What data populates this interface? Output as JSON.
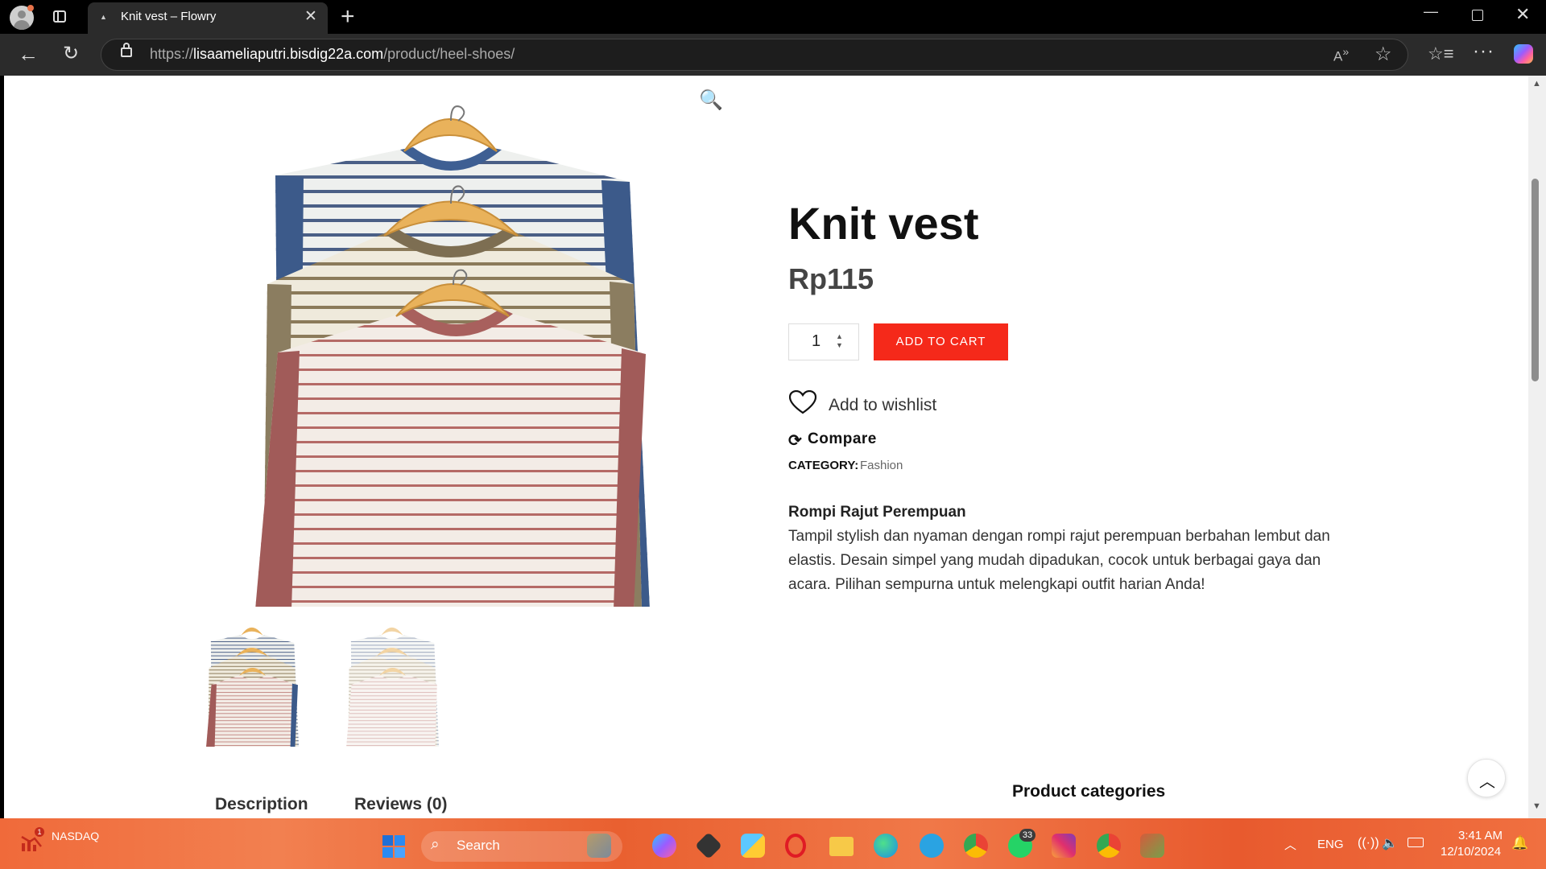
{
  "browser": {
    "tab_title": "Knit vest – Flowry",
    "url_scheme": "https://",
    "url_host": "lisaameliaputri.bisdig22a.com",
    "url_path": "/product/heel-shoes/"
  },
  "product": {
    "title": "Knit vest",
    "price": "Rp115",
    "quantity": "1",
    "add_to_cart": "ADD TO CART",
    "wishlist": "Add to wishlist",
    "compare": "Compare",
    "category_label": "CATEGORY:",
    "category_value": "Fashion",
    "description_title": "Rompi Rajut Perempuan",
    "description_body": "Tampil stylish dan nyaman dengan rompi rajut perempuan berbahan lembut dan elastis. Desain simpel yang mudah dipadukan, cocok untuk berbagai gaya dan acara. Pilihan sempurna untuk melengkapi outfit harian Anda!"
  },
  "tabs": {
    "description": "Description",
    "reviews": "Reviews (0)"
  },
  "sidebar": {
    "heading": "Product categories"
  },
  "taskbar": {
    "stock_name": "NASDAQ",
    "stock_badge": "1",
    "search_label": "Search",
    "whatsapp_badge": "33",
    "language": "ENG",
    "time": "3:41 AM",
    "date": "12/10/2024"
  },
  "colors": {
    "accent": "#f5291a",
    "page_bg": "#ffffff",
    "taskbar": "#f06a3a"
  }
}
